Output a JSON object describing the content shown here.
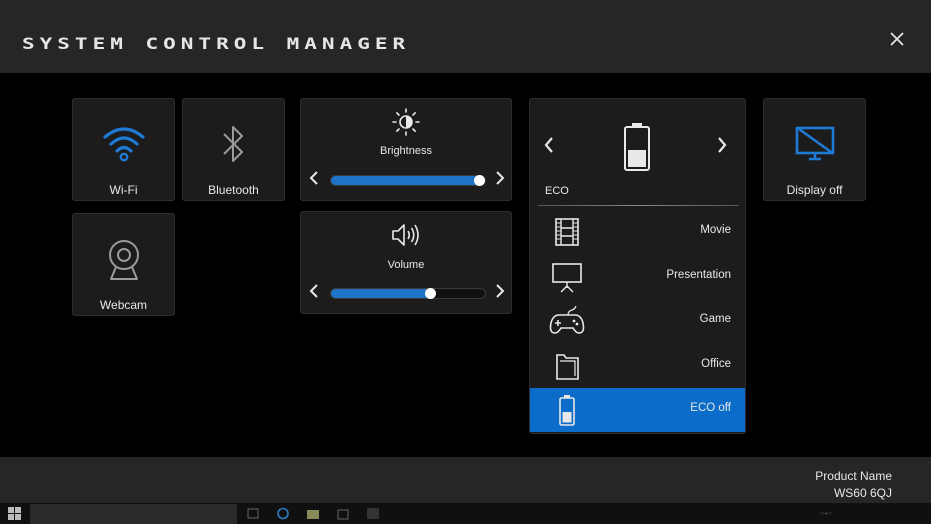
{
  "app": {
    "title": "SYSTEM CONTROL MANAGER",
    "close_icon": "close-icon"
  },
  "tiles": {
    "wifi": {
      "label": "Wi-Fi",
      "icon": "wifi-icon",
      "color": "#1f7ad6"
    },
    "bluetooth": {
      "label": "Bluetooth",
      "icon": "bluetooth-icon"
    },
    "webcam": {
      "label": "Webcam",
      "icon": "webcam-icon"
    },
    "display_off": {
      "label": "Display off",
      "icon": "monitor-off-icon",
      "color": "#1f7ad6"
    }
  },
  "brightness": {
    "label": "Brightness",
    "icon": "brightness-icon",
    "level": 0.97
  },
  "volume": {
    "label": "Volume",
    "icon": "speaker-icon",
    "level": 0.65
  },
  "power_mode": {
    "current_label": "ECO",
    "icon": "battery-icon",
    "modes": [
      {
        "label": "Movie",
        "icon": "film-icon",
        "active": false
      },
      {
        "label": "Presentation",
        "icon": "projector-screen-icon",
        "active": false
      },
      {
        "label": "Game",
        "icon": "gamepad-icon",
        "active": false
      },
      {
        "label": "Office",
        "icon": "folder-icon",
        "active": false
      },
      {
        "label": "ECO off",
        "icon": "battery-icon",
        "active": true
      }
    ]
  },
  "footer": {
    "product_name_label": "Product Name",
    "product_model": "WS60 6QJ"
  },
  "accent": "#0b6cc9"
}
